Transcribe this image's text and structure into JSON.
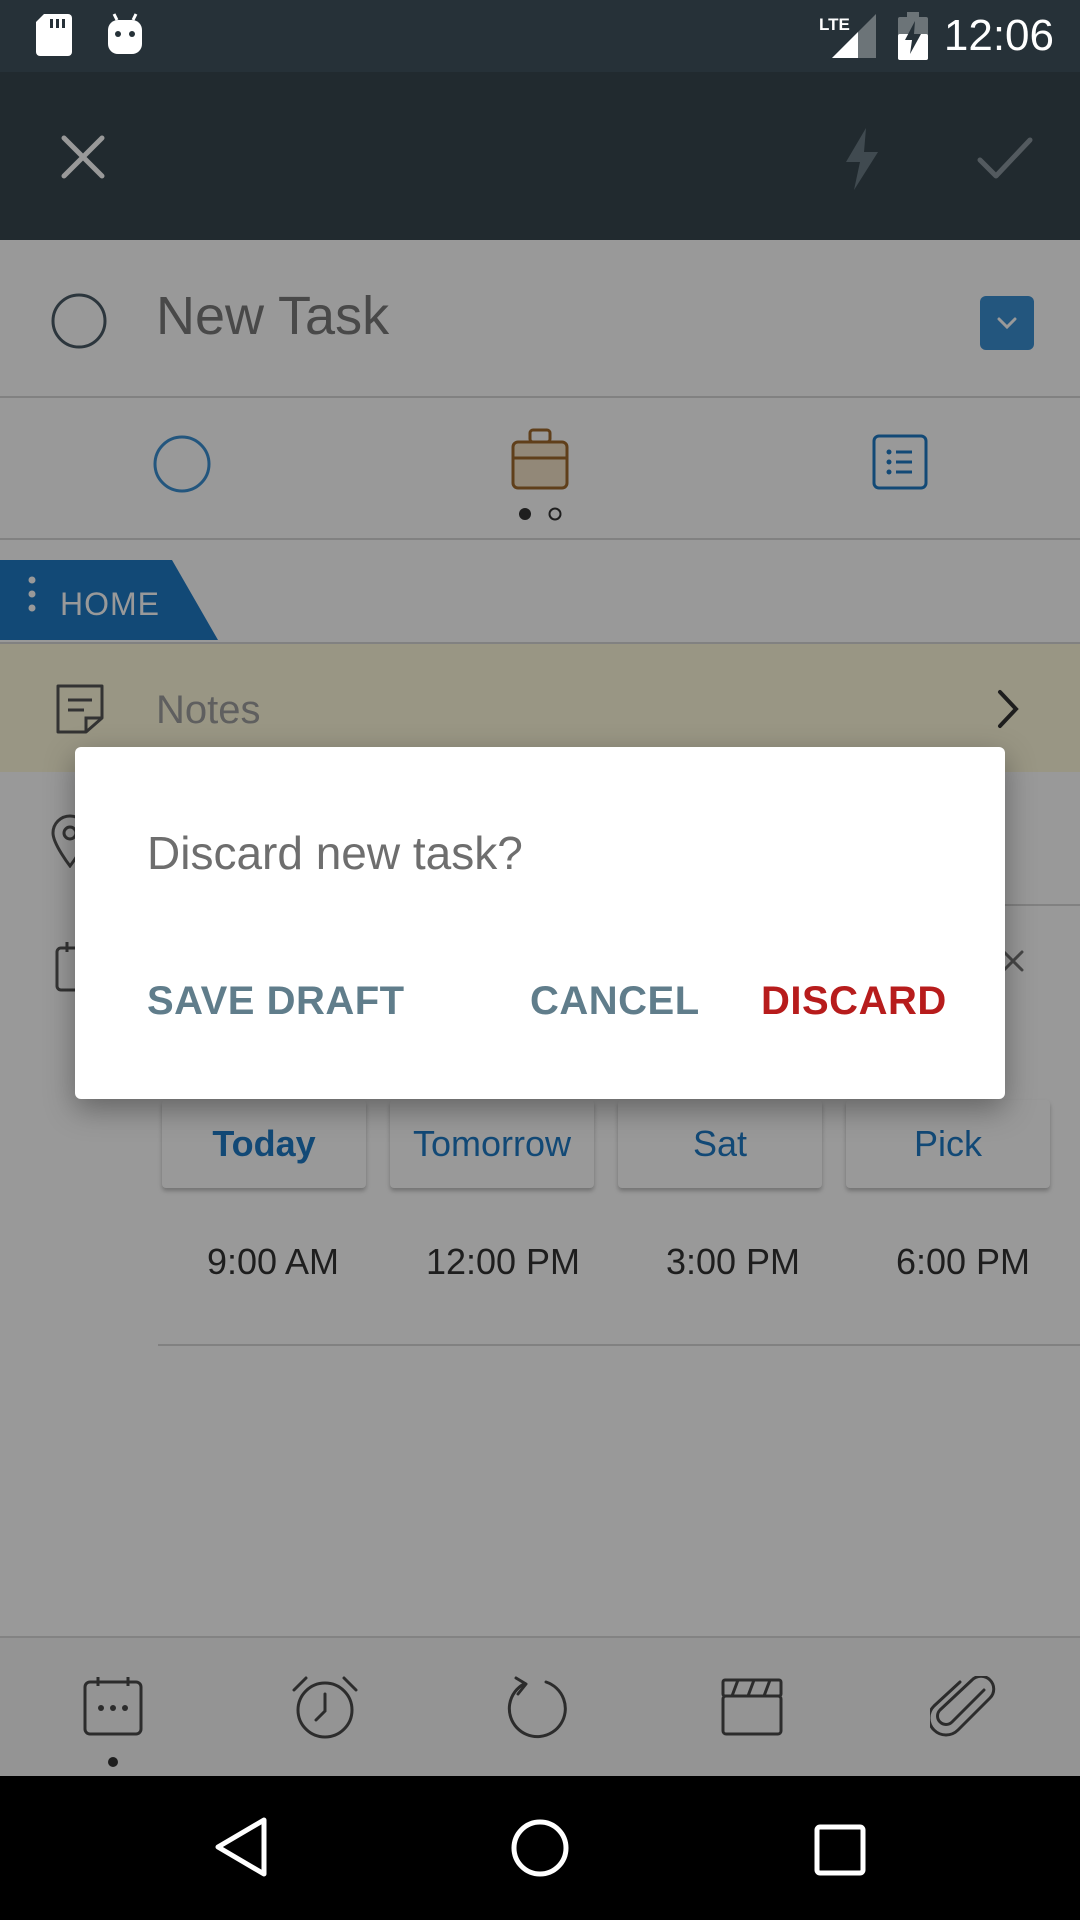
{
  "status_bar": {
    "time": "12:06",
    "network": "LTE",
    "icons": [
      "sd-card-icon",
      "android-icon",
      "lte-signal-icon",
      "battery-charging-icon"
    ]
  },
  "app_bar": {
    "close_icon": "close-icon",
    "quick_action_icon": "lightning-icon",
    "confirm_icon": "check-icon"
  },
  "task": {
    "title": "New Task",
    "list_tag": "HOME",
    "notes_placeholder": "Notes"
  },
  "due_date": {
    "options": [
      "Today",
      "Tomorrow",
      "Sat",
      "Pick"
    ],
    "times": [
      "9:00 AM",
      "12:00 PM",
      "3:00 PM",
      "6:00 PM"
    ]
  },
  "bottom_toolbar": {
    "icons": [
      "calendar-icon",
      "alarm-icon",
      "repeat-icon",
      "clapperboard-icon",
      "paperclip-icon"
    ]
  },
  "dialog": {
    "title": "Discard new task?",
    "buttons": {
      "save_draft": "SAVE DRAFT",
      "cancel": "CANCEL",
      "discard": "DISCARD"
    }
  },
  "colors": {
    "status_bar": "#263138",
    "app_bar": "#37474f",
    "accent_blue": "#1f7ac5",
    "dialog_neutral_button": "#607d8b",
    "dialog_destructive_button": "#b71c1c",
    "notes_background": "#fffbdc"
  }
}
